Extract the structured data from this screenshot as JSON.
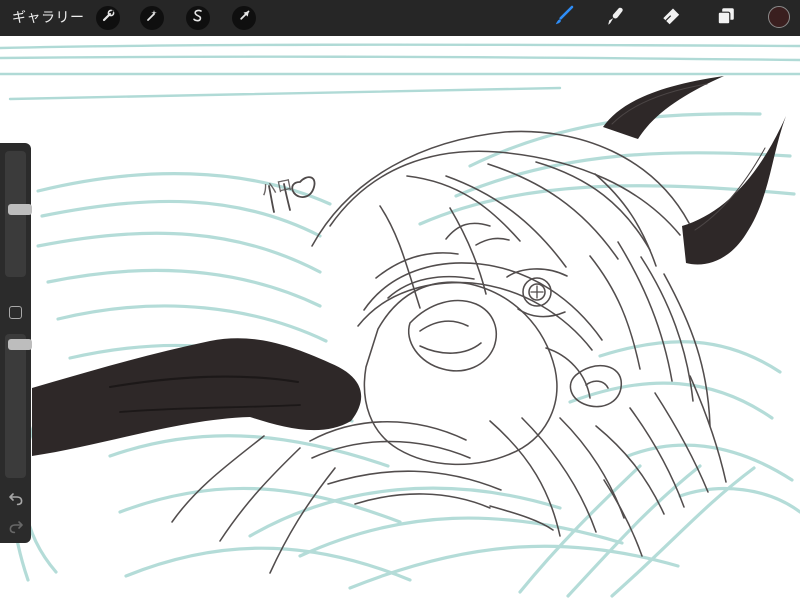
{
  "toolbar": {
    "gallery_label": "ギャラリー",
    "left_tools": [
      {
        "name": "actions",
        "icon": "wrench-icon"
      },
      {
        "name": "adjustments",
        "icon": "magic-wand-icon"
      },
      {
        "name": "selection",
        "icon": "selection-s-icon"
      },
      {
        "name": "transform",
        "icon": "arrow-cursor-icon"
      }
    ],
    "right_tools": [
      {
        "name": "brush",
        "icon": "brush-icon",
        "active": true
      },
      {
        "name": "smudge",
        "icon": "smudge-icon",
        "active": false
      },
      {
        "name": "eraser",
        "icon": "eraser-icon",
        "active": false
      },
      {
        "name": "layers",
        "icon": "layers-icon",
        "active": false
      }
    ],
    "current_color": "#3a1f1f"
  },
  "sidebar": {
    "brush_size": 0.46,
    "opacity": 0.96,
    "undo_icon": "undo-icon",
    "redo_icon": "redo-icon"
  },
  "canvas": {
    "sketch_text": "ハロ",
    "colors": {
      "sketch": "#a8d7d2",
      "lineart": "#4f4a4a",
      "ink": "#2e2828",
      "background": "#ffffff"
    }
  }
}
